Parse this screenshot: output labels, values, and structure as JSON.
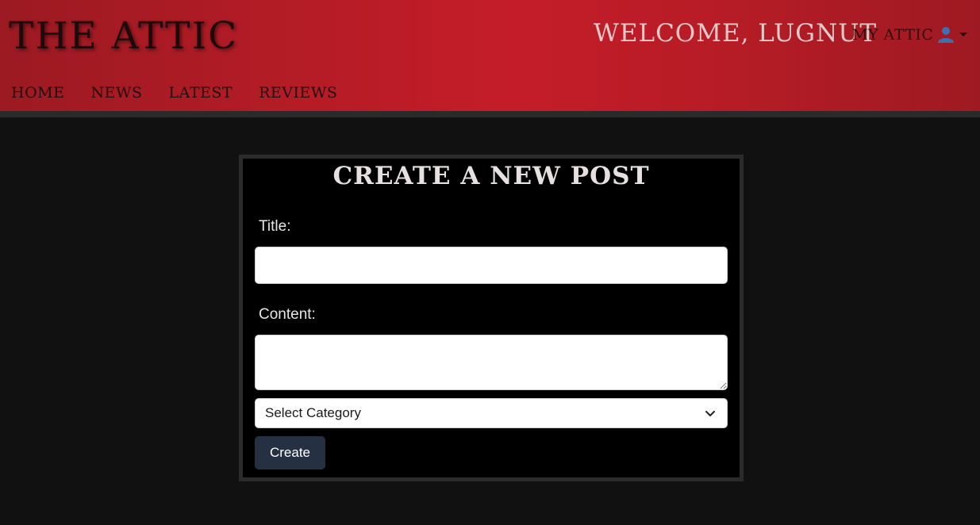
{
  "header": {
    "brand": "THE ATTIC",
    "welcome": "WELCOME, LUGNUT",
    "my_attic": "MY ATTIC",
    "user_icon": "user-icon",
    "accent_color": "#c41d29"
  },
  "nav": {
    "items": [
      {
        "label": "HOME"
      },
      {
        "label": "NEWS"
      },
      {
        "label": "LATEST"
      },
      {
        "label": "REVIEWS"
      }
    ]
  },
  "form": {
    "title": "CREATE A NEW POST",
    "title_label": "Title:",
    "title_value": "",
    "content_label": "Content:",
    "content_value": "",
    "category_selected": "Select Category",
    "submit_label": "Create",
    "button_color": "#253143"
  }
}
